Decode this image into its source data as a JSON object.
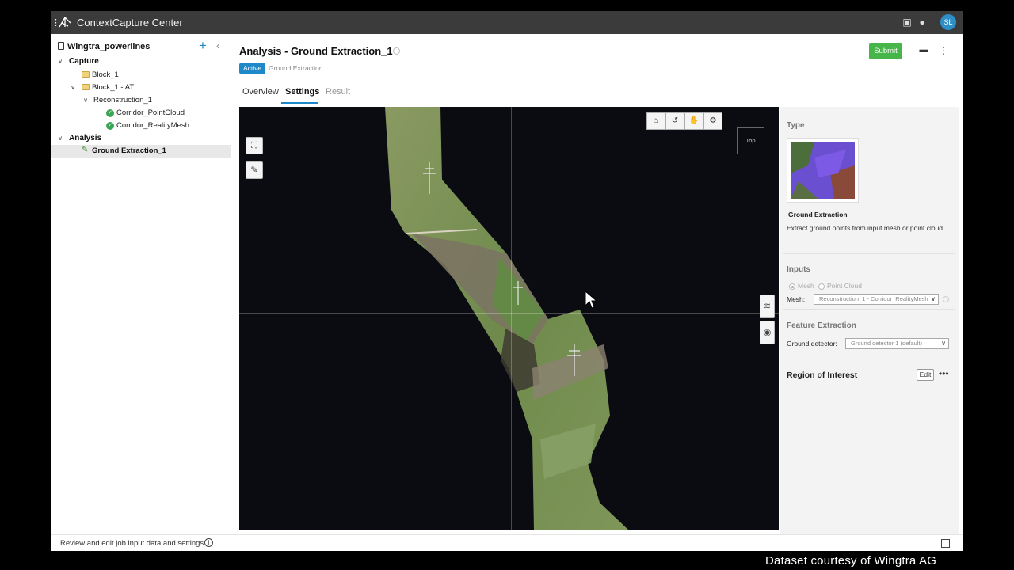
{
  "app": {
    "title": "ContextCapture Center",
    "user_initials": "SL"
  },
  "sidebar": {
    "project": "Wingtra_powerlines",
    "tree": [
      {
        "label": "Capture",
        "kind": "group"
      },
      {
        "label": "Block_1",
        "kind": "folder"
      },
      {
        "label": "Block_1 - AT",
        "kind": "folder"
      },
      {
        "label": "Reconstruction_1",
        "kind": "node"
      },
      {
        "label": "Corridor_PointCloud",
        "kind": "done"
      },
      {
        "label": "Corridor_RealityMesh",
        "kind": "done"
      },
      {
        "label": "Analysis",
        "kind": "group"
      },
      {
        "label": "Ground Extraction_1",
        "kind": "job",
        "selected": true
      }
    ]
  },
  "header": {
    "title": "Analysis -  Ground Extraction_1",
    "status": "Active",
    "job_type": "Ground Extraction",
    "submit_label": "Submit"
  },
  "tabs": [
    {
      "label": "Overview",
      "state": "normal"
    },
    {
      "label": "Settings",
      "state": "active"
    },
    {
      "label": "Result",
      "state": "disabled"
    }
  ],
  "viewer": {
    "view_cube_label": "Top"
  },
  "panel": {
    "type_title": "Type",
    "type_name": "Ground Extraction",
    "type_description": "Extract ground points from input mesh or point cloud.",
    "inputs_title": "Inputs",
    "input_options": [
      "Mesh",
      "Point Cloud"
    ],
    "selected_input": "Mesh",
    "mesh_label": "Mesh:",
    "mesh_value": "Reconstruction_1 - Corridor_RealityMesh",
    "feature_title": "Feature Extraction",
    "detector_label": "Ground detector:",
    "detector_value": "Ground detector 1 (default)",
    "roi_title": "Region of Interest",
    "edit_label": "Edit"
  },
  "status": {
    "message": "Review and edit job input data and settings."
  },
  "credit": "Dataset courtesy of Wingtra AG",
  "colors": {
    "accent": "#1e88c9",
    "submit": "#46b64a",
    "titlebar": "#3b3b3b",
    "viewport": "#0b0c12"
  }
}
